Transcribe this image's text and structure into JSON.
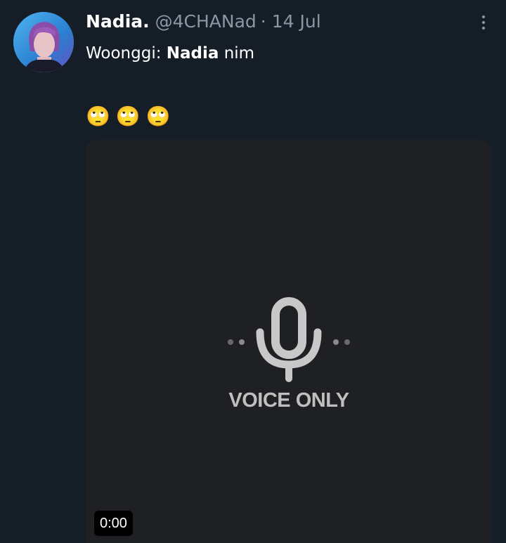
{
  "tweet": {
    "display_name": "Nadia.",
    "handle": "@4CHANad",
    "separator": "·",
    "date": "14 Jul",
    "text_prefix": "Woonggi: ",
    "text_bold": "Nadia",
    "text_suffix": " nim",
    "emojis": [
      "🙄",
      "🙄",
      "🙄"
    ]
  },
  "media": {
    "label": "VOICE ONLY",
    "time": "0:00"
  },
  "colors": {
    "background": "#151d26",
    "media_background": "#1f2023",
    "secondary_text": "#8899a6"
  },
  "icons": {
    "more": "more-vertical-icon",
    "microphone": "microphone-icon"
  }
}
